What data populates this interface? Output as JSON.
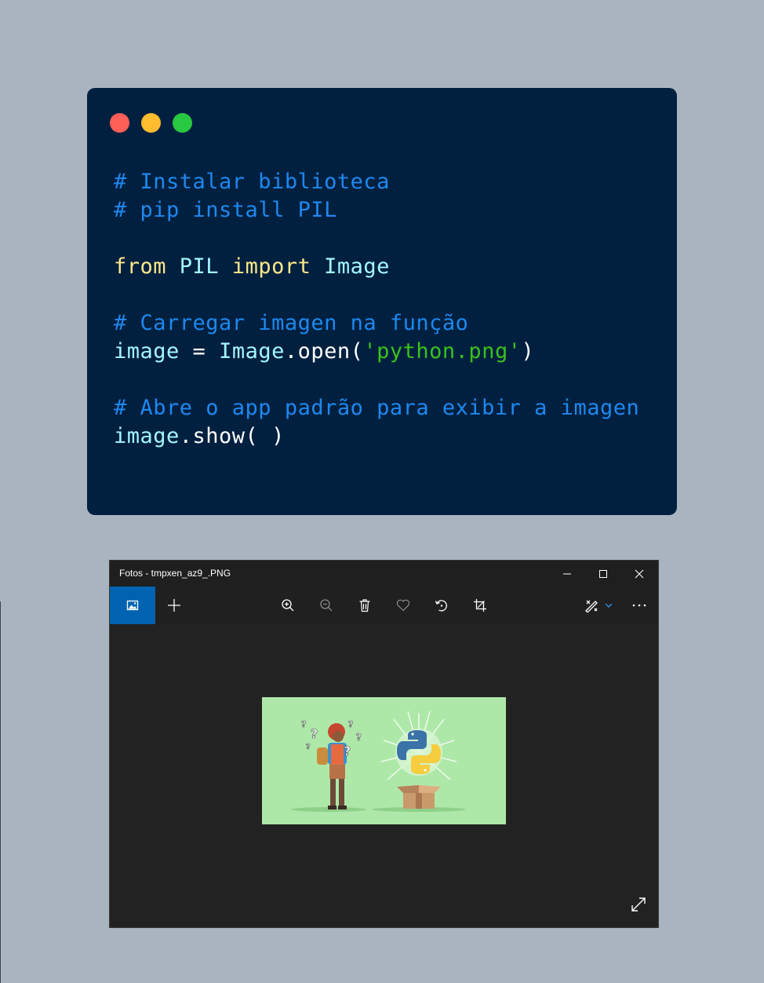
{
  "code_window": {
    "traffic_lights": {
      "close_color": "#fe5f57",
      "minimize_color": "#febc2e",
      "maximize_color": "#28c840"
    },
    "lines": [
      [
        {
          "t": "# Instalar biblioteca",
          "c": "comment"
        }
      ],
      [
        {
          "t": "# pip install PIL",
          "c": "comment"
        }
      ],
      [],
      [
        {
          "t": "from",
          "c": "keyword"
        },
        {
          "t": " ",
          "c": "plain"
        },
        {
          "t": "PIL",
          "c": "ident"
        },
        {
          "t": " ",
          "c": "plain"
        },
        {
          "t": "import",
          "c": "keyword"
        },
        {
          "t": " ",
          "c": "plain"
        },
        {
          "t": "Image",
          "c": "ident"
        }
      ],
      [],
      [
        {
          "t": "# Carregar imagen na função",
          "c": "comment"
        }
      ],
      [
        {
          "t": "image",
          "c": "ident"
        },
        {
          "t": " = ",
          "c": "plain"
        },
        {
          "t": "Image",
          "c": "ident"
        },
        {
          "t": ".open(",
          "c": "plain"
        },
        {
          "t": "'python.png'",
          "c": "string"
        },
        {
          "t": ")",
          "c": "plain"
        }
      ],
      [],
      [
        {
          "t": "# Abre o app padrão para exibir a imagen",
          "c": "comment"
        }
      ],
      [
        {
          "t": "image",
          "c": "ident"
        },
        {
          "t": ".show( )",
          "c": "plain"
        }
      ]
    ]
  },
  "photos_window": {
    "title": "Fotos - tmpxen_az9_.PNG",
    "accent": "#0063b1",
    "toolbar": {
      "left": [
        "gallery-icon",
        "add-icon"
      ],
      "center": [
        "zoom-in-icon",
        "zoom-out-icon",
        "delete-icon",
        "favorite-icon",
        "rotate-icon",
        "crop-icon"
      ],
      "right": [
        "edit-draw-icon",
        "chevron-down-icon",
        "more-icon"
      ]
    },
    "window_controls": [
      "minimize-icon",
      "maximize-icon",
      "close-icon"
    ],
    "image_preview": {
      "subject": "person with question marks next to python logo on a box",
      "background": "#aee8a9"
    }
  }
}
